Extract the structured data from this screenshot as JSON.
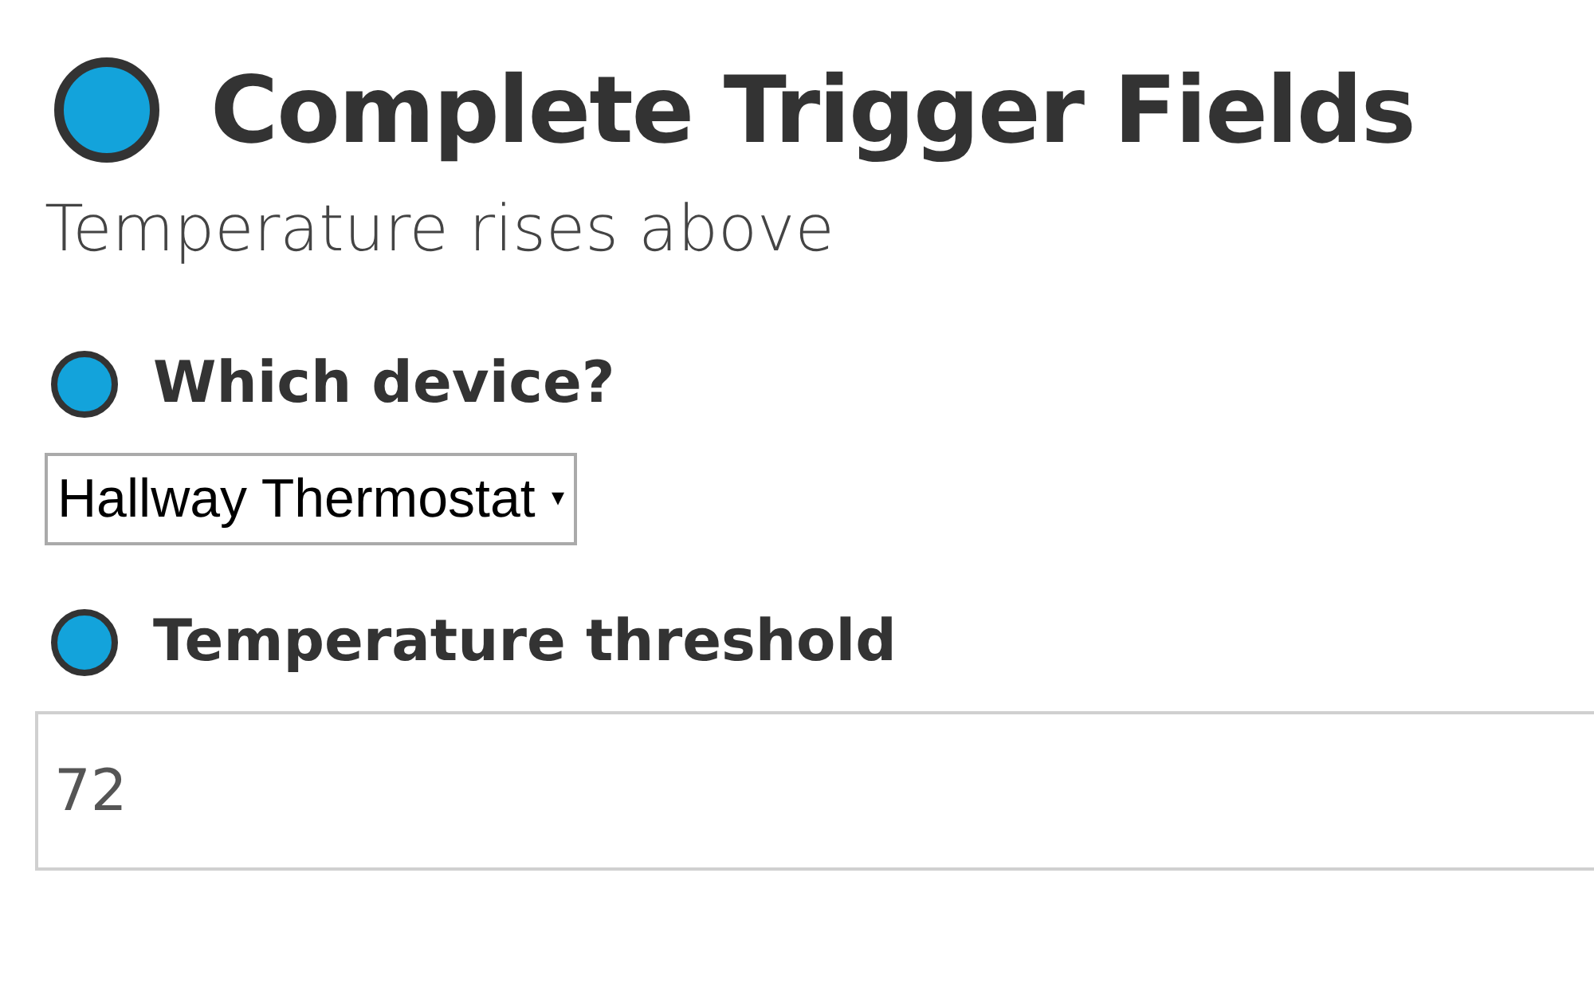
{
  "title": "Complete Trigger Fields",
  "subtitle": "Temperature rises above",
  "fields": [
    {
      "kind": "select",
      "label": "Which device?",
      "value": "Hallway Thermostat",
      "caret": "▾"
    },
    {
      "kind": "text",
      "label": "Temperature threshold",
      "value": "72"
    }
  ]
}
